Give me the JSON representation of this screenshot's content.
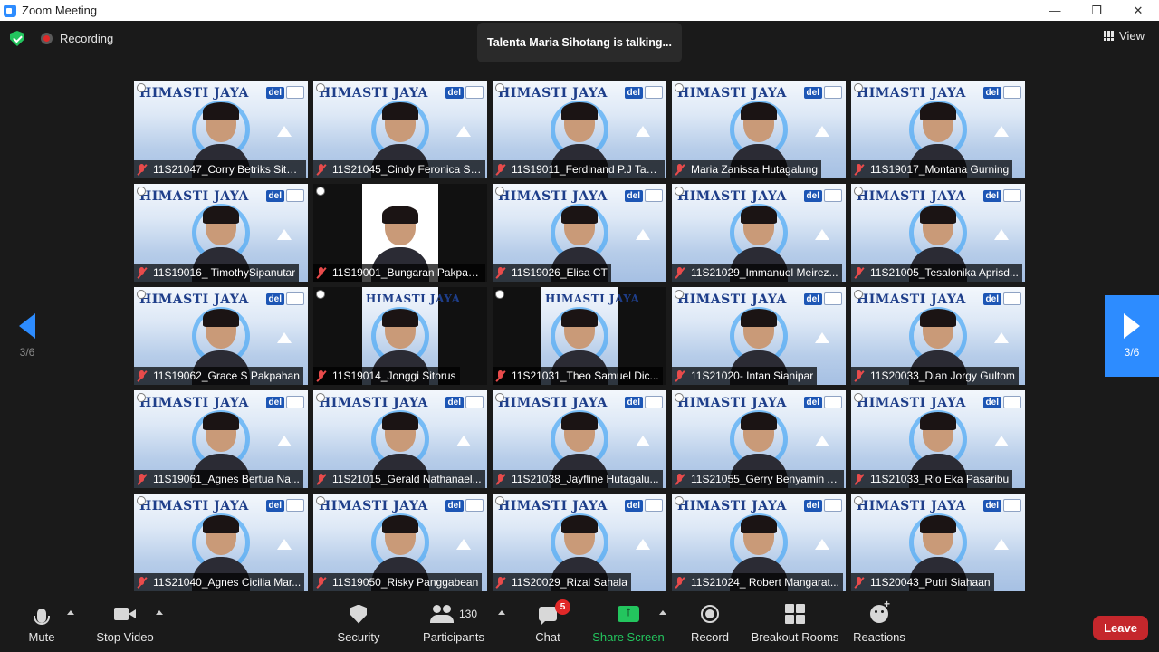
{
  "window": {
    "title": "Zoom Meeting",
    "minimize": "—",
    "maximize": "❐",
    "close": "✕"
  },
  "topbar": {
    "recording_label": "Recording",
    "talking_banner": "Talenta Maria Sihotang is talking...",
    "view_label": "View"
  },
  "pagination": {
    "left_page": "3/6",
    "right_page": "3/6"
  },
  "tile_banner": {
    "org": "HIMASTI JAYA",
    "logo": "del"
  },
  "participants": [
    {
      "name": "11S21047_Corry Betriks Sitor..."
    },
    {
      "name": "11S21045_Cindy Feronica Si..."
    },
    {
      "name": "11S19011_Ferdinand P.J Tam..."
    },
    {
      "name": "Maria Zanissa Hutagalung"
    },
    {
      "name": "11S19017_Montana Gurning"
    },
    {
      "name": "11S19016_ TimothySipanutar"
    },
    {
      "name": "11S19001_Bungaran Pakpah..."
    },
    {
      "name": "11S19026_Elisa CT"
    },
    {
      "name": "11S21029_Immanuel Meirez..."
    },
    {
      "name": "11S21005_Tesalonika Aprisd..."
    },
    {
      "name": "11S19062_Grace S Pakpahan"
    },
    {
      "name": "11S19014_Jonggi Sitorus"
    },
    {
      "name": "11S21031_Theo Samuel Dic..."
    },
    {
      "name": "11S21020- Intan Sianipar"
    },
    {
      "name": "11S20033_Dian Jorgy Gultom"
    },
    {
      "name": "11S19061_Agnes Bertua Na..."
    },
    {
      "name": "11S21015_Gerald Nathanael..."
    },
    {
      "name": "11S21038_Jayfline Hutagalu..."
    },
    {
      "name": "11S21055_Gerry Benyamin A..."
    },
    {
      "name": "11S21033_Rio Eka Pasaribu"
    },
    {
      "name": "11S21040_Agnes Cicilia Mar..."
    },
    {
      "name": "11S19050_Risky Panggabean"
    },
    {
      "name": "11S20029_Rizal Sahala"
    },
    {
      "name": "11S21024_ Robert Mangarat..."
    },
    {
      "name": "11S20043_Putri Siahaan"
    }
  ],
  "toolbar": {
    "mute": "Mute",
    "stop_video": "Stop Video",
    "security": "Security",
    "participants": "Participants",
    "participants_count": "130",
    "chat": "Chat",
    "chat_badge": "5",
    "share_screen": "Share Screen",
    "record": "Record",
    "breakout_rooms": "Breakout Rooms",
    "reactions": "Reactions",
    "leave": "Leave"
  },
  "colors": {
    "accent": "#2d8cff",
    "share_green": "#23c55e",
    "leave_red": "#c5272c",
    "muted_red": "#e84b4b"
  },
  "icons": [
    "zoom-app-icon",
    "shield-check-icon",
    "recording-icon",
    "grid-view-icon",
    "mic-off-icon",
    "microphone-icon",
    "video-camera-icon",
    "security-shield-icon",
    "participants-icon",
    "chat-icon",
    "share-screen-icon",
    "record-icon",
    "breakout-rooms-icon",
    "reactions-icon"
  ]
}
